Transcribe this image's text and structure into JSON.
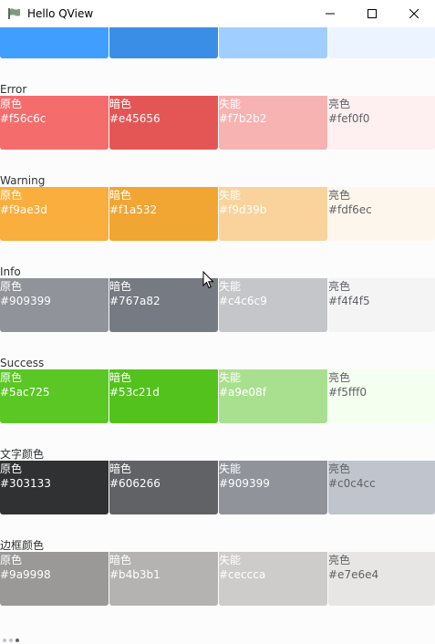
{
  "window": {
    "title": "Hello QView"
  },
  "top_partial": {
    "colors": [
      "#409eff",
      "#3a8ee6",
      "#a0cfff",
      "#ecf5ff"
    ]
  },
  "groups": [
    {
      "title": "Error",
      "swatches": [
        {
          "name": "原色",
          "hex": "#f56c6c",
          "color": "#f56c6c"
        },
        {
          "name": "暗色",
          "hex": "#e45656",
          "color": "#e45656"
        },
        {
          "name": "失能",
          "hex": "#f7b2b2",
          "color": "#f7b2b2"
        },
        {
          "name": "亮色",
          "hex": "#fef0f0",
          "color": "#fef0f0"
        }
      ]
    },
    {
      "title": "Warning",
      "swatches": [
        {
          "name": "原色",
          "hex": "#f9ae3d",
          "color": "#f9ae3d"
        },
        {
          "name": "暗色",
          "hex": "#f1a532",
          "color": "#f1a532"
        },
        {
          "name": "失能",
          "hex": "#f9d39b",
          "color": "#f9d39b"
        },
        {
          "name": "亮色",
          "hex": "#fdf6ec",
          "color": "#fdf6ec"
        }
      ]
    },
    {
      "title": "Info",
      "swatches": [
        {
          "name": "原色",
          "hex": "#909399",
          "color": "#909399"
        },
        {
          "name": "暗色",
          "hex": "#767a82",
          "color": "#767a82"
        },
        {
          "name": "失能",
          "hex": "#c4c6c9",
          "color": "#c4c6c9"
        },
        {
          "name": "亮色",
          "hex": "#f4f4f5",
          "color": "#f4f4f5"
        }
      ]
    },
    {
      "title": "Success",
      "swatches": [
        {
          "name": "原色",
          "hex": "#5ac725",
          "color": "#5ac725"
        },
        {
          "name": "暗色",
          "hex": "#53c21d",
          "color": "#53c21d"
        },
        {
          "name": "失能",
          "hex": "#a9e08f",
          "color": "#a9e08f"
        },
        {
          "name": "亮色",
          "hex": "#f5fff0",
          "color": "#f5fff0"
        }
      ]
    },
    {
      "title": "文字颜色",
      "swatches": [
        {
          "name": "原色",
          "hex": "#303133",
          "color": "#303133"
        },
        {
          "name": "暗色",
          "hex": "#606266",
          "color": "#606266"
        },
        {
          "name": "失能",
          "hex": "#909399",
          "color": "#909399"
        },
        {
          "name": "亮色",
          "hex": "#c0c4cc",
          "color": "#c0c4cc"
        }
      ]
    },
    {
      "title": "边框颜色",
      "swatches": [
        {
          "name": "原色",
          "hex": "#9a9998",
          "color": "#9a9998"
        },
        {
          "name": "暗色",
          "hex": "#b4b3b1",
          "color": "#b4b3b1"
        },
        {
          "name": "失能",
          "hex": "#ceccca",
          "color": "#ceccca"
        },
        {
          "name": "亮色",
          "hex": "#e7e6e4",
          "color": "#e7e6e4"
        }
      ]
    }
  ],
  "icons": {
    "app": "app-flag-icon",
    "minimize": "minimize-icon",
    "maximize": "maximize-icon",
    "close": "close-icon",
    "cursor": "mouse-pointer-icon"
  }
}
